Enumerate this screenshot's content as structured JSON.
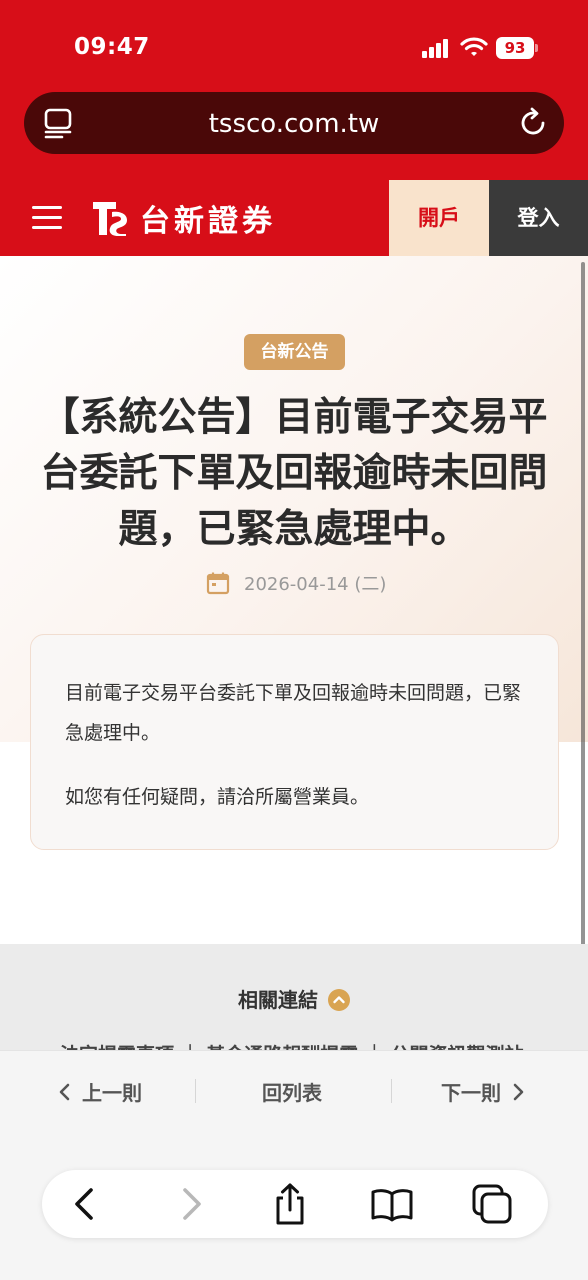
{
  "status_bar": {
    "time": "09:47",
    "battery": "93"
  },
  "browser": {
    "url": "tssco.com.tw"
  },
  "site_nav": {
    "brand": "台新證券",
    "open_account": "開戶",
    "login": "登入"
  },
  "article": {
    "category_badge": "台新公告",
    "title": "【系統公告】目前電子交易平台委託下單及回報逾時未回問題，已緊急處理中。",
    "date": "2026-04-14 (二)",
    "paragraphs": [
      "目前電子交易平台委託下單及回報逾時未回問題，已緊急處理中。",
      "如您有任何疑問，請洽所屬營業員。"
    ]
  },
  "footer": {
    "related_links": "相關連結",
    "links_peek": "法定揭露事項 ｜ 基金通路報酬揭露 ｜ 公開資訊觀測站"
  },
  "pager": {
    "prev": "上一則",
    "list": "回列表",
    "next": "下一則"
  },
  "colors": {
    "brand_red": "#d70e18",
    "accent_gold": "#d4a062",
    "open_bg": "#f9e3cc"
  }
}
